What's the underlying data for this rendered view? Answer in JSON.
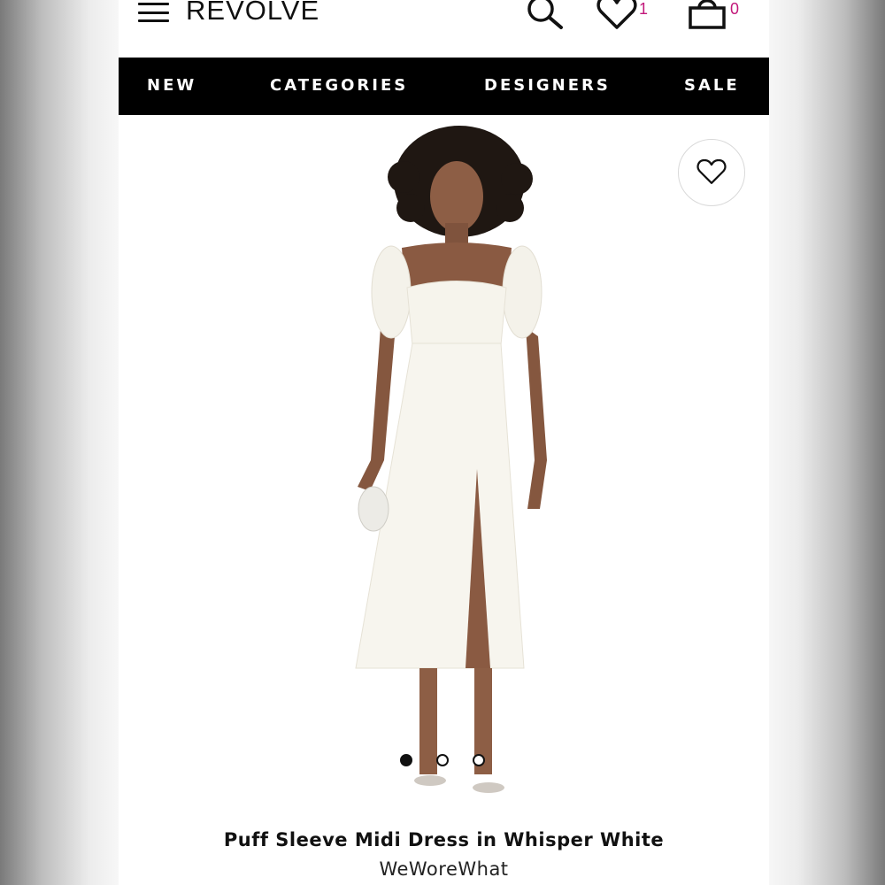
{
  "header": {
    "logo": "REVOLVE",
    "menu_icon": "hamburger-menu-icon",
    "search_icon": "search-icon",
    "wishlist_icon": "heart-icon",
    "wishlist_count": "1",
    "bag_icon": "shopping-bag-icon",
    "bag_count": "0",
    "count_color": "#c2187a"
  },
  "nav": {
    "items": [
      {
        "label": "NEW"
      },
      {
        "label": "CATEGORIES"
      },
      {
        "label": "DESIGNERS"
      },
      {
        "label": "SALE"
      }
    ],
    "background": "#000000"
  },
  "product": {
    "favorite_icon": "heart-icon",
    "image_count": 3,
    "active_image": 1,
    "title": "Puff Sleeve Midi Dress in Whisper White",
    "brand": "WeWoreWhat"
  }
}
